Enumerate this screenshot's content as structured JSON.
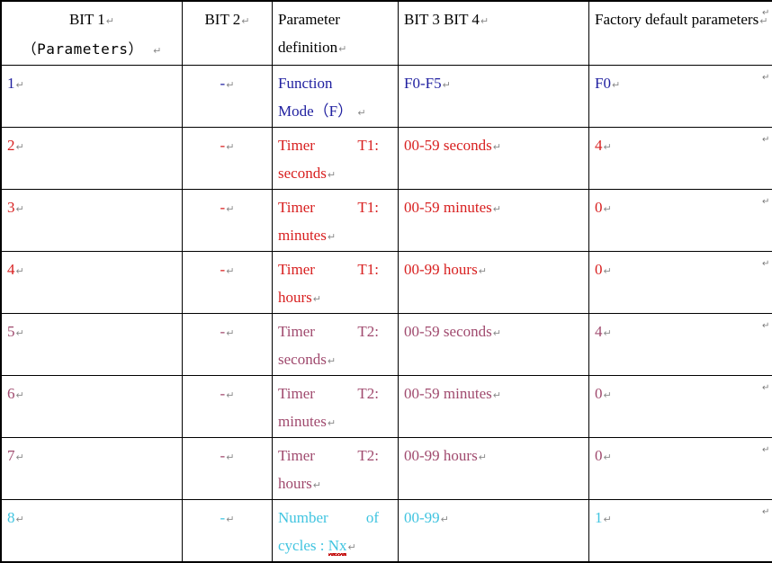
{
  "document": {
    "type": "word-table",
    "paragraph_mark": "↵",
    "colors": {
      "header_text": "#000000",
      "row1_blue": "#2020A0",
      "rows234_red": "#D82020",
      "rows567_plum": "#A04A6E",
      "row8_cyan": "#40C4E0",
      "border": "#000000",
      "spellcheck_underline": "#C00000",
      "pilcrow": "#8A8A8A"
    }
  },
  "table": {
    "headers": [
      {
        "line1": "BIT 1",
        "line2": "（Parameters）"
      },
      {
        "line1": "BIT 2",
        "line2": ""
      },
      {
        "line1": "Parameter",
        "line2": "definition"
      },
      {
        "line1": "BIT 3 BIT 4",
        "line2": ""
      },
      {
        "line1": "Factory default parameters",
        "line2": ""
      }
    ],
    "rows": [
      {
        "bit1": "1",
        "bit2": "-",
        "definition_line1": "Function",
        "definition_line2": "Mode（F）",
        "bit34": "F0-F5",
        "factory_default": "F0",
        "color": "#2020A0",
        "misspelled": false
      },
      {
        "bit1": "2",
        "bit2": "-",
        "definition_line1": "Timer T1:",
        "definition_line2": "seconds",
        "bit34": "00-59 seconds",
        "factory_default": "4",
        "color": "#D82020",
        "misspelled": false
      },
      {
        "bit1": "3",
        "bit2": "-",
        "definition_line1": "Timer T1:",
        "definition_line2": "minutes",
        "bit34": "00-59 minutes",
        "factory_default": "0",
        "color": "#D82020",
        "misspelled": false
      },
      {
        "bit1": "4",
        "bit2": "-",
        "definition_line1": "Timer T1:",
        "definition_line2": "hours",
        "bit34": "00-99 hours",
        "factory_default": "0",
        "color": "#D82020",
        "misspelled": false
      },
      {
        "bit1": "5",
        "bit2": "-",
        "definition_line1": "Timer T2:",
        "definition_line2": "seconds",
        "bit34": "00-59 seconds",
        "factory_default": "4",
        "color": "#A04A6E",
        "misspelled": false
      },
      {
        "bit1": "6",
        "bit2": "-",
        "definition_line1": "Timer T2:",
        "definition_line2": "minutes",
        "bit34": "00-59 minutes",
        "factory_default": "0",
        "color": "#A04A6E",
        "misspelled": false
      },
      {
        "bit1": "7",
        "bit2": "-",
        "definition_line1": "Timer T2:",
        "definition_line2": "hours",
        "bit34": "00-99 hours",
        "factory_default": "0",
        "color": "#A04A6E",
        "misspelled": false
      },
      {
        "bit1": "8",
        "bit2": "-",
        "definition_line1": "Number of",
        "definition_line2_prefix": "cycles : ",
        "definition_line2_misspelled": "Nx",
        "bit34": "00-99",
        "factory_default": "1",
        "color": "#40C4E0",
        "misspelled": true
      }
    ]
  }
}
